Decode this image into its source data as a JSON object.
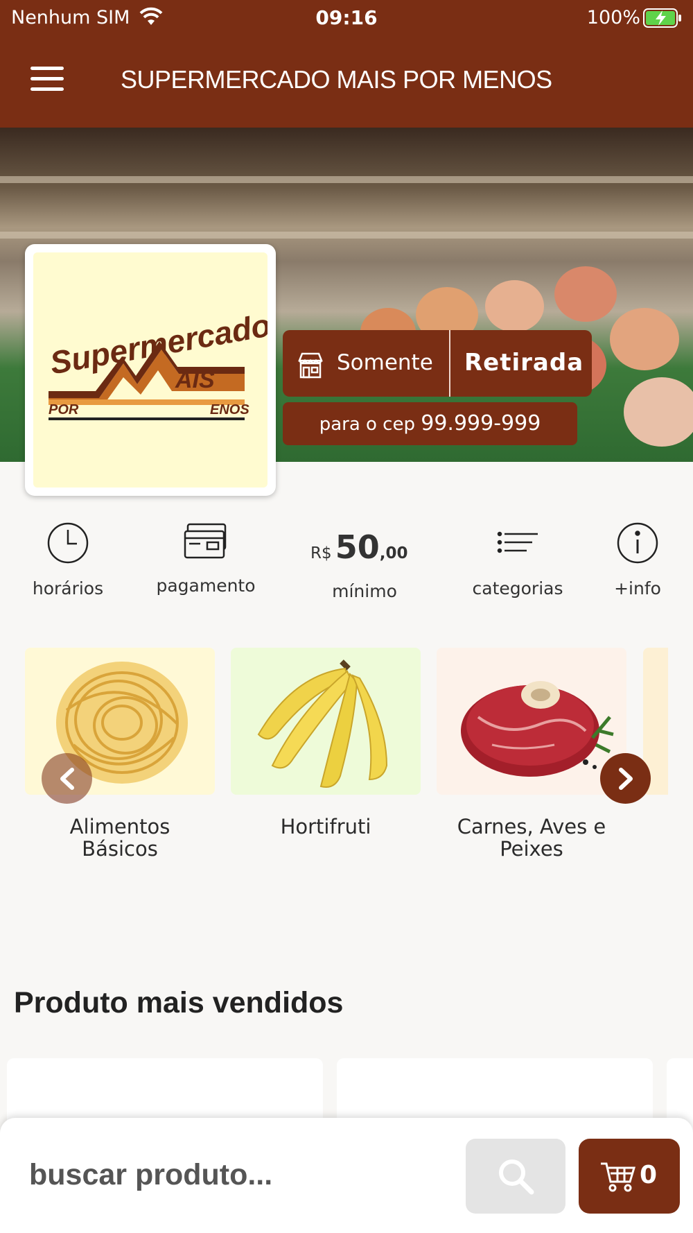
{
  "status_bar": {
    "carrier": "Nenhum SIM",
    "time": "09:16",
    "battery": "100%"
  },
  "header": {
    "title": "SUPERMERCADO MAIS POR MENOS",
    "menu_icon": "hamburger-menu-icon"
  },
  "store": {
    "logo_text": {
      "line1": "Supermercado",
      "line2": "AIS",
      "por": "POR",
      "menos": "ENOS"
    },
    "pickup_prefix": "Somente",
    "pickup_mode": "Retirada",
    "cep_label": "para o cep",
    "cep_value": "99.999-999"
  },
  "info_bar": {
    "hours": "horários",
    "payment": "pagamento",
    "min_currency": "R$",
    "min_integer": "50",
    "min_decimal": ",00",
    "min_label": "mínimo",
    "categories": "categorias",
    "more_info": "+info"
  },
  "categories": [
    {
      "label": "Alimentos\nBásicos",
      "bg": "#fff9d6"
    },
    {
      "label": "Hortifruti",
      "bg": "#eefbd9"
    },
    {
      "label": "Carnes, Aves e\nPeixes",
      "bg": "#fdf2ea"
    }
  ],
  "best_sellers": {
    "title": "Produto mais vendidos"
  },
  "bottom_bar": {
    "search_placeholder": "buscar produto...",
    "cart_count": "0"
  },
  "colors": {
    "brand": "#7a2e14",
    "background": "#f8f7f5"
  }
}
